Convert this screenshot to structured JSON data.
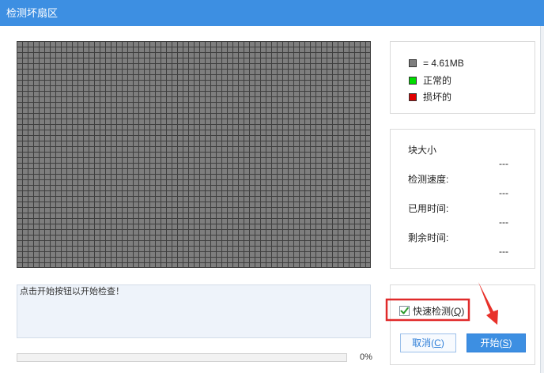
{
  "window": {
    "title": "检测坏扇区"
  },
  "legend": {
    "items": [
      {
        "label": "= 4.61MB",
        "color": "#7e7e7e"
      },
      {
        "label": "正常的",
        "color": "#00dd00"
      },
      {
        "label": "损坏的",
        "color": "#e00000"
      }
    ]
  },
  "stats": [
    {
      "label": "块大小",
      "value": "---"
    },
    {
      "label": "检测速度:",
      "value": "---"
    },
    {
      "label": "已用时间:",
      "value": "---"
    },
    {
      "label": "剩余时间:",
      "value": "---"
    }
  ],
  "log": {
    "message": "点击开始按钮以开始检查！"
  },
  "progress": {
    "percent": 0,
    "label": "0%"
  },
  "options": {
    "quick_check": {
      "label": "快速检测(Q)",
      "checked": true
    }
  },
  "buttons": {
    "cancel": "取消(C)",
    "start": "开始(S)"
  },
  "colors": {
    "accent": "#3d8fe2",
    "sector_unchecked": "#7e7e7e",
    "annotation": "#e02a2a",
    "check": "#2a9a2a"
  }
}
